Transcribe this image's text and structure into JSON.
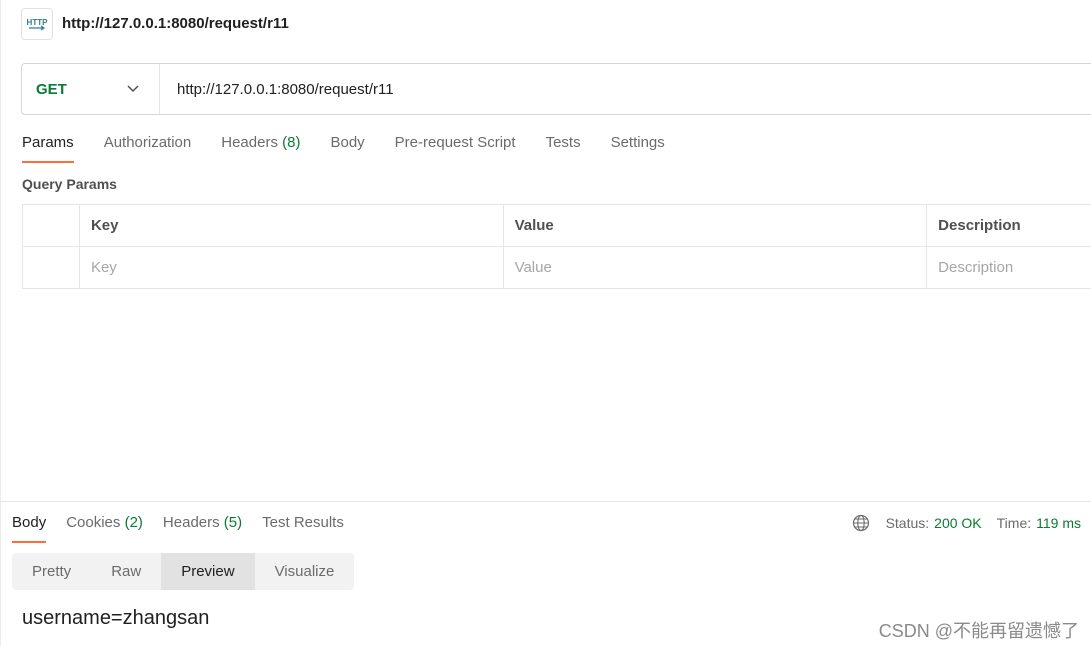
{
  "request": {
    "title": "http://127.0.0.1:8080/request/r11",
    "method": "GET",
    "url": "http://127.0.0.1:8080/request/r11"
  },
  "request_tabs": [
    {
      "label": "Params",
      "count": ""
    },
    {
      "label": "Authorization",
      "count": ""
    },
    {
      "label": "Headers",
      "count": "(8)"
    },
    {
      "label": "Body",
      "count": ""
    },
    {
      "label": "Pre-request Script",
      "count": ""
    },
    {
      "label": "Tests",
      "count": ""
    },
    {
      "label": "Settings",
      "count": ""
    }
  ],
  "query_params": {
    "title": "Query Params",
    "headers": [
      "Key",
      "Value",
      "Description"
    ],
    "placeholders": [
      "Key",
      "Value",
      "Description"
    ]
  },
  "response_tabs": [
    {
      "label": "Body",
      "count": ""
    },
    {
      "label": "Cookies",
      "count": "(2)"
    },
    {
      "label": "Headers",
      "count": "(5)"
    },
    {
      "label": "Test Results",
      "count": ""
    }
  ],
  "status": {
    "status_label": "Status:",
    "status_value": "200 OK",
    "time_label": "Time:",
    "time_value": "119 ms"
  },
  "view_modes": [
    "Pretty",
    "Raw",
    "Preview",
    "Visualize"
  ],
  "response_body": "username=zhangsan",
  "watermark": "CSDN @不能再留遗憾了",
  "colors": {
    "accent": "#ff6c37",
    "method": "#0b7a36",
    "status": "#0b7a36"
  },
  "icons": [
    "http-icon",
    "chevron-down-icon",
    "globe-icon"
  ]
}
